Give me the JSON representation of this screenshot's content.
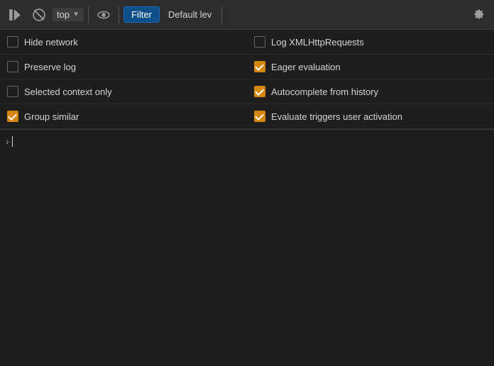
{
  "toolbar": {
    "execute_icon": "▶",
    "stop_icon": "⊘",
    "context_label": "top",
    "filter_label": "Filter",
    "default_level_label": "Default lev",
    "gear_icon": "⚙"
  },
  "options": [
    {
      "id": "hide-network",
      "label": "Hide network",
      "checked": false
    },
    {
      "id": "log-xmlhttp",
      "label": "Log XMLHttpRequests",
      "checked": false
    },
    {
      "id": "preserve-log",
      "label": "Preserve log",
      "checked": false
    },
    {
      "id": "eager-evaluation",
      "label": "Eager evaluation",
      "checked": true
    },
    {
      "id": "selected-context",
      "label": "Selected context only",
      "checked": false
    },
    {
      "id": "autocomplete-history",
      "label": "Autocomplete from history",
      "checked": true
    },
    {
      "id": "group-similar",
      "label": "Group similar",
      "checked": true
    },
    {
      "id": "evaluate-triggers",
      "label": "Evaluate triggers user activation",
      "checked": true
    }
  ],
  "console": {
    "prompt_symbol": "›"
  }
}
